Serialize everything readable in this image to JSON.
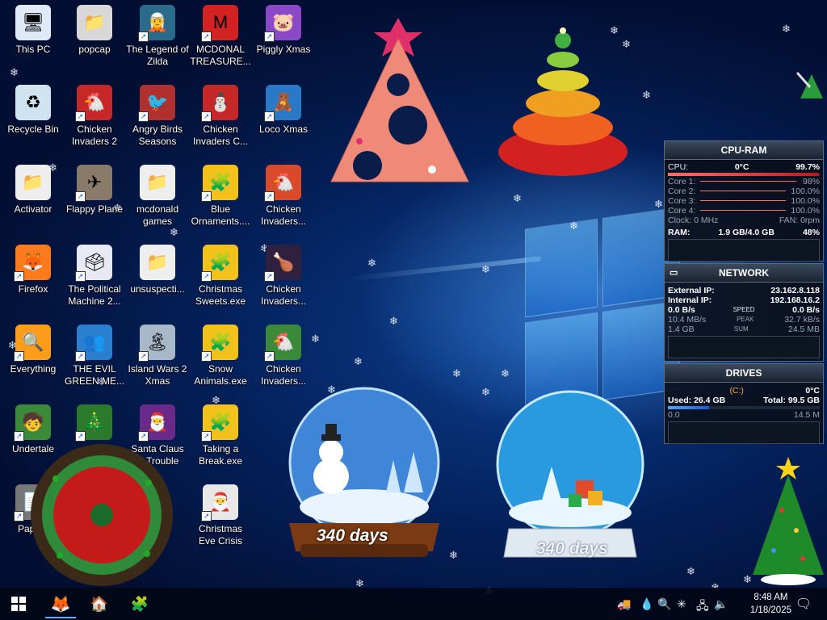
{
  "desktop_icons": [
    {
      "label": "This PC",
      "glyph": "🖥",
      "bg": "#dfe9f7",
      "shortcut": false
    },
    {
      "label": "Recycle Bin",
      "glyph": "♻",
      "bg": "#cfe3f0",
      "shortcut": false
    },
    {
      "label": "Activator",
      "glyph": "📁",
      "bg": "#eeeeee",
      "shortcut": false
    },
    {
      "label": "Firefox",
      "glyph": "🦊",
      "bg": "#ff7a1a",
      "shortcut": true
    },
    {
      "label": "Everything",
      "glyph": "🔍",
      "bg": "#ff9c1a",
      "shortcut": true
    },
    {
      "label": "Undertale",
      "glyph": "🧒",
      "bg": "#3a8a3a",
      "shortcut": true
    },
    {
      "label": "Papers",
      "glyph": "📄",
      "bg": "#777777",
      "shortcut": true
    },
    {
      "label": "popcap",
      "glyph": "📁",
      "bg": "#d8d8d8",
      "shortcut": false
    },
    {
      "label": "Chicken Invaders 2",
      "glyph": "🐔",
      "bg": "#c62828",
      "shortcut": true
    },
    {
      "label": "Flappy Plane",
      "glyph": "✈",
      "bg": "#8a7a6a",
      "shortcut": true
    },
    {
      "label": "The Political Machine 2...",
      "glyph": "🗳",
      "bg": "#e9e9f5",
      "shortcut": true
    },
    {
      "label": "THE EVIL GREEN ME...",
      "glyph": "👥",
      "bg": "#2a7fd0",
      "shortcut": true
    },
    {
      "label": "Chr",
      "glyph": "🎄",
      "bg": "#2b7a2b",
      "shortcut": true
    },
    {
      "label": "The Legend of Zilda",
      "glyph": "🧝",
      "bg": "#2a6a8a",
      "shortcut": true
    },
    {
      "label": "Angry Birds Seasons",
      "glyph": "🐦",
      "bg": "#b03030",
      "shortcut": true
    },
    {
      "label": "mcdonald games",
      "glyph": "📁",
      "bg": "#eeeeee",
      "shortcut": false
    },
    {
      "label": "unsuspecti...",
      "glyph": "📁",
      "bg": "#eeeeee",
      "shortcut": false
    },
    {
      "label": "Island Wars 2 Xmas",
      "glyph": "🏝",
      "bg": "#a8b8c8",
      "shortcut": true
    },
    {
      "label": "Santa Claus in Trouble",
      "glyph": "🎅",
      "bg": "#6a2a8a",
      "shortcut": true
    },
    {
      "label": "MCDONAL TREASURE...",
      "glyph": "M",
      "bg": "#d32222",
      "shortcut": true
    },
    {
      "label": "Chicken Invaders C...",
      "glyph": "⛄",
      "bg": "#c62828",
      "shortcut": true
    },
    {
      "label": "Blue Ornaments....",
      "glyph": "🧩",
      "bg": "#f3c21a",
      "shortcut": true
    },
    {
      "label": "Christmas Sweets.exe",
      "glyph": "🧩",
      "bg": "#f3c21a",
      "shortcut": true
    },
    {
      "label": "Snow Animals.exe",
      "glyph": "🧩",
      "bg": "#f3c21a",
      "shortcut": true
    },
    {
      "label": "Taking a Break.exe",
      "glyph": "🧩",
      "bg": "#f3c21a",
      "shortcut": true
    },
    {
      "label": "Christmas Eve Crisis",
      "glyph": "🎅",
      "bg": "#e8e8e8",
      "shortcut": true
    },
    {
      "label": "Piggly Xmas",
      "glyph": "🐷",
      "bg": "#8a4ac8",
      "shortcut": true
    },
    {
      "label": "Loco Xmas",
      "glyph": "🧸",
      "bg": "#2a78c8",
      "shortcut": true
    },
    {
      "label": "Chicken Invaders...",
      "glyph": "🐔",
      "bg": "#d84a2a",
      "shortcut": true
    },
    {
      "label": "Chicken Invaders...",
      "glyph": "🍗",
      "bg": "#302040",
      "shortcut": true
    },
    {
      "label": "Chicken Invaders...",
      "glyph": "🐔",
      "bg": "#3a8a3a",
      "shortcut": true
    }
  ],
  "cpu_ram": {
    "title": "CPU-RAM",
    "cpu_label": "CPU:",
    "cpu_temp": "0°C",
    "cpu_value": "99.7%",
    "cpu_level": 0.997,
    "cores": [
      {
        "label": "Core 1:",
        "value": "98%",
        "level": 0.98
      },
      {
        "label": "Core 2:",
        "value": "100.0%",
        "level": 1.0
      },
      {
        "label": "Core 3:",
        "value": "100.0%",
        "level": 1.0
      },
      {
        "label": "Core 4:",
        "value": "100.0%",
        "level": 1.0
      }
    ],
    "clock": "Clock: 0 MHz",
    "fan": "FAN: 0rpm",
    "ram_label": "RAM:",
    "ram_value": "1.9 GB/4.0 GB",
    "ram_pct": "48%",
    "ram_level": 0.48
  },
  "network": {
    "title": "NETWORK",
    "external_label": "External IP:",
    "external_ip": "23.162.8.118",
    "internal_label": "Internal IP:",
    "internal_ip": "192.168.16.2",
    "up_speed": "0.0 B/s",
    "speed_label": "SPEED",
    "down_speed": "0.0 B/s",
    "up_peak": "10.4 MB/s",
    "peak_label": "PEAK",
    "down_peak": "32.7 kB/s",
    "up_sum": "1.4 GB",
    "sum_label": "SUM",
    "down_sum": "24.5 MB"
  },
  "drives": {
    "title": "DRIVES",
    "drive": "(C:)",
    "temp": "0°C",
    "used": "Used: 26.4 GB",
    "total": "Total: 99.5 GB",
    "read": "0.0",
    "write": "14.5 M"
  },
  "globes": [
    {
      "days": "340 days"
    },
    {
      "days": "340 days"
    }
  ],
  "taskbar": {
    "time": "8:48 AM",
    "date": "1/18/2025"
  },
  "colors": {
    "accent": "#0b3f8f",
    "gadget_bg": "#0a0e18",
    "star": "#ffd21a"
  }
}
